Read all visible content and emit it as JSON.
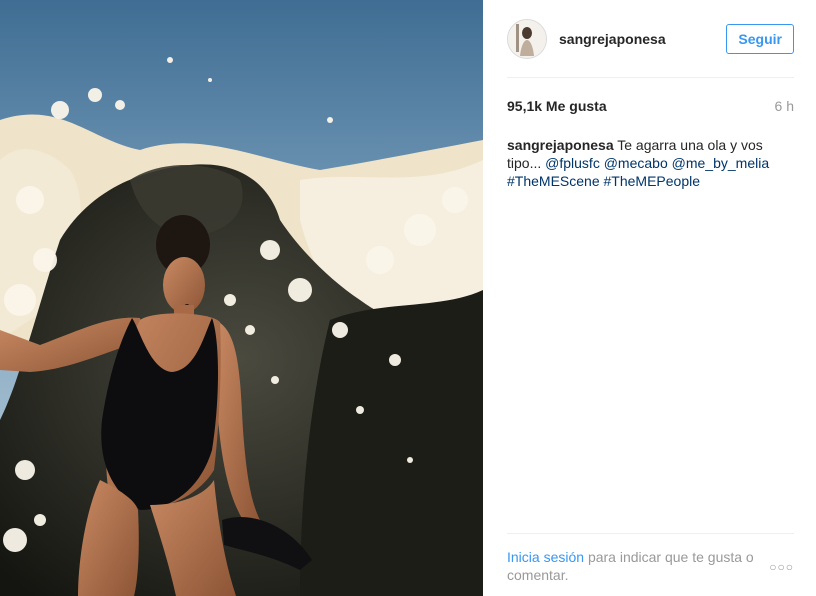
{
  "post": {
    "username": "sangrejaponesa",
    "follow_label": "Seguir",
    "likes": "95,1k Me gusta",
    "time": "6 h",
    "caption": {
      "user": "sangrejaponesa",
      "text": "Te agarra una ola y vos tipo...",
      "mentions": [
        "@fplusfc",
        "@mecabo",
        "@me_by_melia"
      ],
      "hashtags": [
        "#TheMEScene",
        "#TheMEPeople"
      ]
    },
    "footer": {
      "login_link": "Inicia sesión",
      "login_text": "para indicar que te gusta o comentar."
    },
    "more_icon": "…"
  },
  "colors": {
    "accent": "#3897f0",
    "link": "#003569",
    "muted": "#999999",
    "text": "#262626"
  },
  "icons": {
    "more": "ellipsis-icon",
    "avatar": "profile-avatar"
  }
}
